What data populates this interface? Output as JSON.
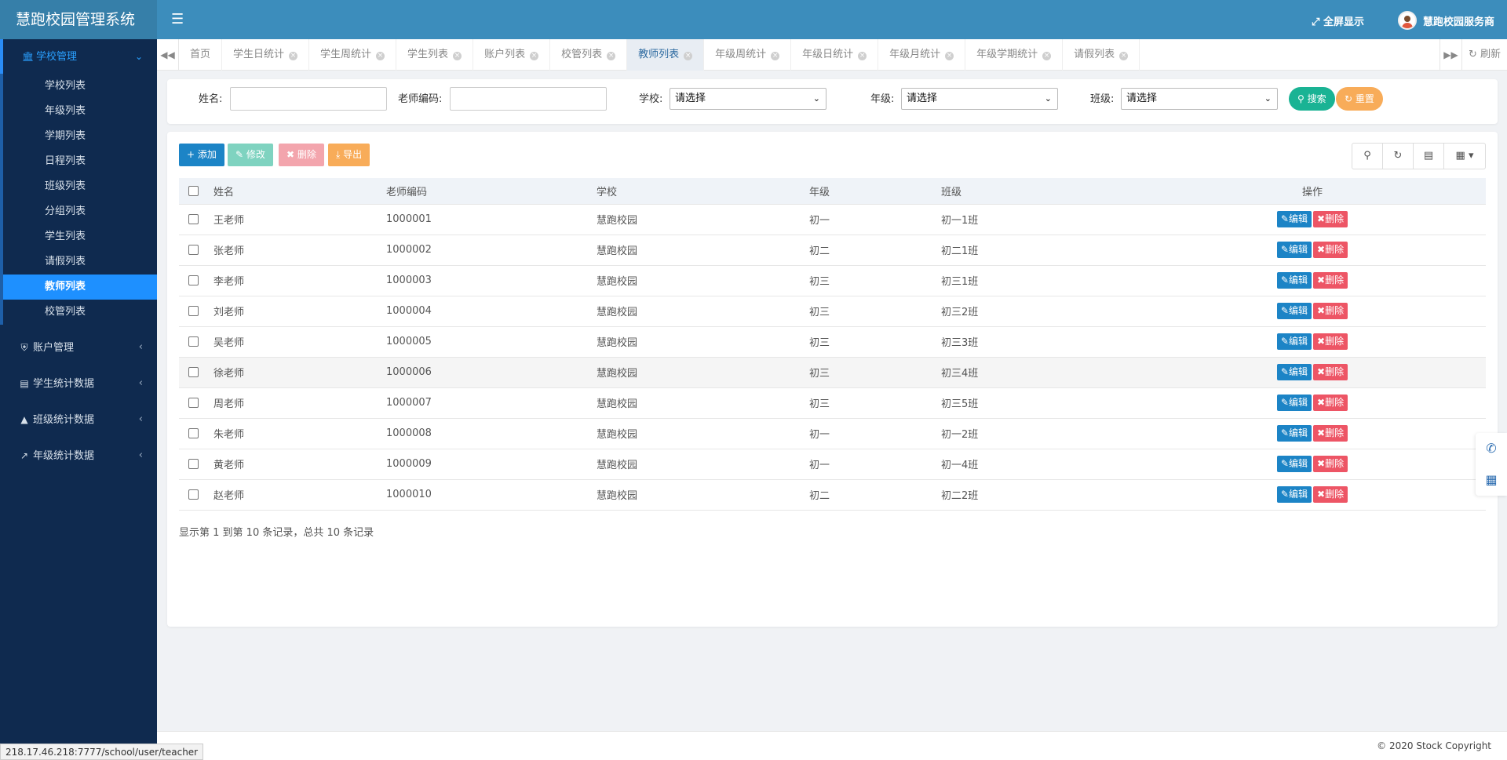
{
  "app": {
    "brand": "慧跑校园管理系统",
    "fullscreen": "全屏显示",
    "user_name": "慧跑校园服务商"
  },
  "sidebar": {
    "groups": [
      {
        "label": "学校管理",
        "expanded": true,
        "items": [
          "学校列表",
          "年级列表",
          "学期列表",
          "日程列表",
          "班级列表",
          "分组列表",
          "学生列表",
          "请假列表",
          "教师列表",
          "校管列表"
        ],
        "active_item": "教师列表"
      },
      {
        "label": "账户管理"
      },
      {
        "label": "学生统计数据"
      },
      {
        "label": "班级统计数据"
      },
      {
        "label": "年级统计数据"
      }
    ]
  },
  "tabs": {
    "items": [
      "首页",
      "学生日统计",
      "学生周统计",
      "学生列表",
      "账户列表",
      "校管列表",
      "教师列表",
      "年级周统计",
      "年级日统计",
      "年级月统计",
      "年级学期统计",
      "请假列表"
    ],
    "active": "教师列表",
    "refresh": "刷新"
  },
  "search": {
    "name_label": "姓名:",
    "code_label": "老师编码:",
    "school_label": "学校:",
    "grade_label": "年级:",
    "class_label": "班级:",
    "select_placeholder": "请选择",
    "search_button": "搜索",
    "reset_button": "重置"
  },
  "toolbar": {
    "add": "添加",
    "edit": "修改",
    "delete": "删除",
    "export": "导出"
  },
  "table": {
    "columns": [
      "姓名",
      "老师编码",
      "学校",
      "年级",
      "班级",
      "操作"
    ],
    "rows": [
      {
        "name": "王老师",
        "code": "1000001",
        "school": "慧跑校园",
        "grade": "初一",
        "class": "初一1班"
      },
      {
        "name": "张老师",
        "code": "1000002",
        "school": "慧跑校园",
        "grade": "初二",
        "class": "初二1班"
      },
      {
        "name": "李老师",
        "code": "1000003",
        "school": "慧跑校园",
        "grade": "初三",
        "class": "初三1班"
      },
      {
        "name": "刘老师",
        "code": "1000004",
        "school": "慧跑校园",
        "grade": "初三",
        "class": "初三2班"
      },
      {
        "name": "吴老师",
        "code": "1000005",
        "school": "慧跑校园",
        "grade": "初三",
        "class": "初三3班"
      },
      {
        "name": "徐老师",
        "code": "1000006",
        "school": "慧跑校园",
        "grade": "初三",
        "class": "初三4班"
      },
      {
        "name": "周老师",
        "code": "1000007",
        "school": "慧跑校园",
        "grade": "初三",
        "class": "初三5班"
      },
      {
        "name": "朱老师",
        "code": "1000008",
        "school": "慧跑校园",
        "grade": "初一",
        "class": "初一2班"
      },
      {
        "name": "黄老师",
        "code": "1000009",
        "school": "慧跑校园",
        "grade": "初一",
        "class": "初一4班"
      },
      {
        "name": "赵老师",
        "code": "1000010",
        "school": "慧跑校园",
        "grade": "初二",
        "class": "初二2班"
      }
    ],
    "edit_label": "编辑",
    "delete_label": "删除"
  },
  "pager": {
    "info": "显示第 1 到第 10 条记录，总共 10 条记录"
  },
  "footer": {
    "copyright": "© 2020 Stock Copyright",
    "status_url": "218.17.46.218:7777/school/user/teacher"
  },
  "colors": {
    "header": "#3c8dbc",
    "sidebar": "#0f2a4f",
    "active_item": "#1e90ff",
    "primary": "#1c84c6",
    "success": "#1ab394",
    "warning": "#f8ac59",
    "danger": "#ed5565"
  }
}
